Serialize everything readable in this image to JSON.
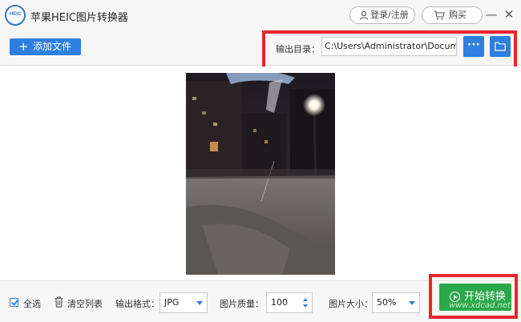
{
  "app": {
    "title": "苹果HEIC图片转换器",
    "logo_text": "HEIC"
  },
  "header": {
    "login_label": "登录/注册",
    "buy_label": "购买",
    "minimize_glyph": "—",
    "close_glyph": "✕"
  },
  "toolbar": {
    "add_label": "添加文件",
    "output_label": "输出目录：",
    "output_path": "C:\\Users\\Administrator\\Documents",
    "more_glyph": "···"
  },
  "bottom": {
    "select_all_label": "全选",
    "clear_label": "清空列表",
    "format_label": "输出格式：",
    "format_value": "JPG",
    "quality_label": "图片质量：",
    "quality_value": "100",
    "size_label": "图片大小：",
    "size_value": "50%",
    "start_label": "开始转换",
    "select_all_checked": true
  },
  "watermark_text": "www.xdcad.net",
  "icons": {
    "add": "plus-icon",
    "user": "user-icon",
    "cart": "cart-icon",
    "folder": "folder-icon",
    "trash": "trash-icon",
    "play": "play-circle-icon"
  },
  "colors": {
    "accent": "#2d7fe0",
    "start": "#2ba84a",
    "highlight": "#e8252d"
  }
}
